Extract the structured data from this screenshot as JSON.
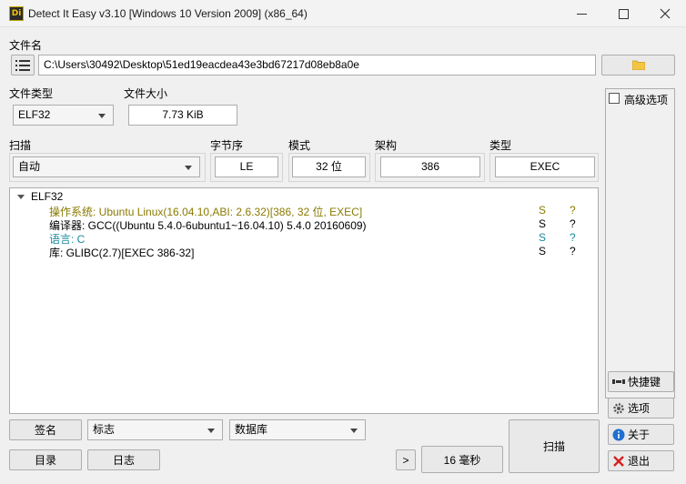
{
  "window": {
    "title": "Detect It Easy v3.10 [Windows 10 Version 2009] (x86_64)",
    "app_icon_text": "Di"
  },
  "file": {
    "label": "文件名",
    "path": "C:\\Users\\30492\\Desktop\\51ed19eacdea43e3bd67217d08eb8a0e"
  },
  "file_type": {
    "label": "文件类型",
    "value": "ELF32"
  },
  "file_size": {
    "label": "文件大小",
    "value": "7.73 KiB"
  },
  "scan": {
    "label": "扫描",
    "value": "自动"
  },
  "endianness": {
    "label": "字节序",
    "value": "LE"
  },
  "mode": {
    "label": "模式",
    "value": "32 位"
  },
  "arch": {
    "label": "架构",
    "value": "386"
  },
  "type": {
    "label": "类型",
    "value": "EXEC"
  },
  "advanced": {
    "label": "高级选项"
  },
  "results": {
    "root": "ELF32",
    "items": [
      {
        "text": "操作系统: Ubuntu Linux(16.04.10,ABI: 2.6.32)[386, 32 位, EXEC]",
        "flag": "S",
        "info": "?",
        "color": "#8a7a00"
      },
      {
        "text": "编译器: GCC((Ubuntu 5.4.0-6ubuntu1~16.04.10) 5.4.0 20160609)",
        "flag": "S",
        "info": "?",
        "color": "#000000"
      },
      {
        "text": "语言: C",
        "flag": "S",
        "info": "?",
        "color": "#1a8a9a"
      },
      {
        "text": "库: GLIBC(2.7)[EXEC 386-32]",
        "flag": "S",
        "info": "?",
        "color": "#000000"
      }
    ]
  },
  "side_buttons": {
    "shortcuts": "快捷键",
    "options": "选项",
    "about": "关于",
    "exit": "退出"
  },
  "bottom": {
    "signature": "签名",
    "flags": "标志",
    "database": "数据库",
    "directory": "目录",
    "log": "日志",
    "more": ">",
    "time": "16 毫秒",
    "scan": "扫描"
  }
}
